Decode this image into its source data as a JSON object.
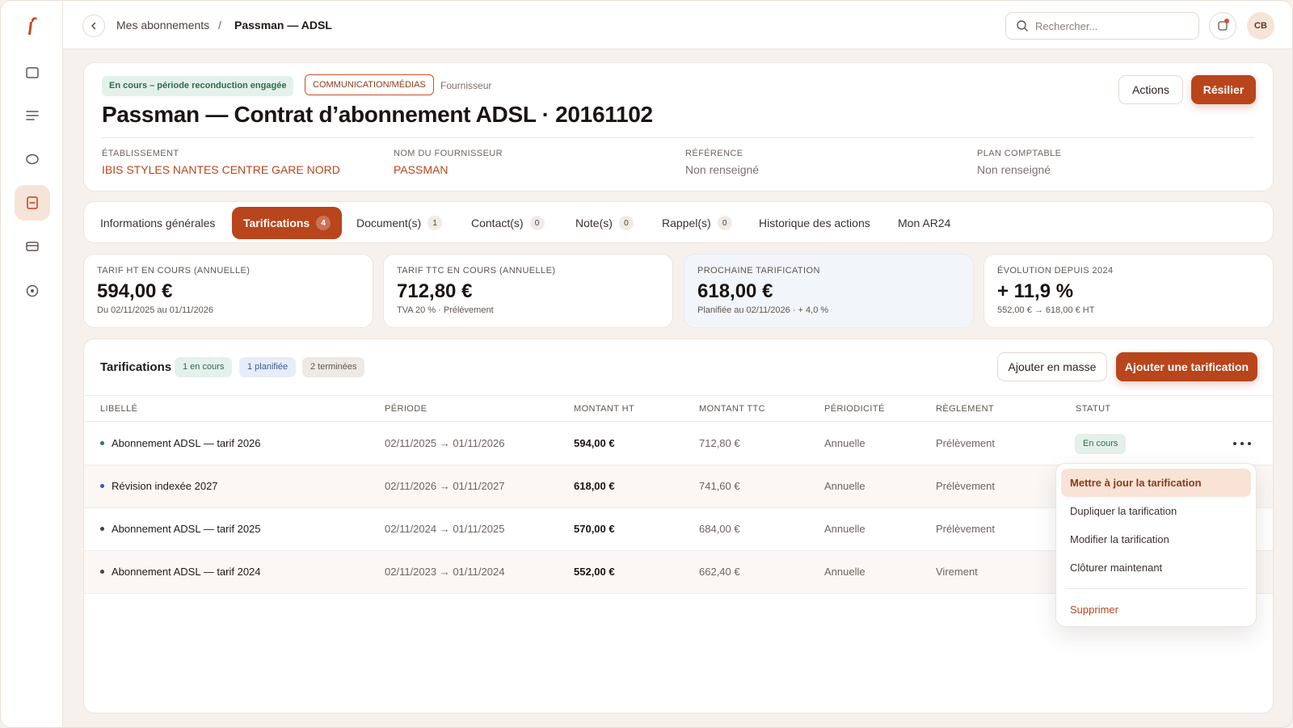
{
  "breadcrumb": {
    "parent": "Mes abonnements",
    "separator": "/",
    "current": "Passman — ADSL"
  },
  "search": {
    "placeholder": "Rechercher..."
  },
  "user": {
    "initials": "CB"
  },
  "sidebar": {
    "items": [
      {
        "icon": "square-icon",
        "active": false
      },
      {
        "icon": "list-icon",
        "active": false
      },
      {
        "icon": "circle-icon",
        "active": false
      },
      {
        "icon": "document-icon",
        "active": true
      },
      {
        "icon": "card-icon",
        "active": false
      },
      {
        "icon": "target-icon",
        "active": false
      }
    ]
  },
  "header": {
    "status_badge": "En cours – période reconduction engagée",
    "category_badge": "COMMUNICATION/MÉDIAS",
    "kind": "Fournisseur",
    "title": "Passman — Contrat d’abonnement ADSL · 20161102",
    "actions_label": "Actions",
    "resilier_label": "Résilier",
    "meta": [
      {
        "label": "ÉTABLISSEMENT",
        "value": "IBIS STYLES NANTES CENTRE GARE NORD"
      },
      {
        "label": "NOM DU FOURNISSEUR",
        "value": "PASSMAN"
      },
      {
        "label": "RÉFÉRENCE",
        "value": "Non renseigné"
      },
      {
        "label": "PLAN COMPTABLE",
        "value": "Non renseigné"
      }
    ]
  },
  "tabs": [
    {
      "label": "Informations générales",
      "count": null
    },
    {
      "label": "Tarifications",
      "count": "4"
    },
    {
      "label": "Document(s)",
      "count": "1"
    },
    {
      "label": "Contact(s)",
      "count": "0"
    },
    {
      "label": "Note(s)",
      "count": "0"
    },
    {
      "label": "Rappel(s)",
      "count": "0"
    },
    {
      "label": "Historique des actions",
      "count": null
    },
    {
      "label": "Mon AR24",
      "count": null
    }
  ],
  "kpis": [
    {
      "label": "TARIF HT EN COURS (ANNUELLE)",
      "value": "594,00 €",
      "sub": "Du 02/11/2025 au 01/11/2026"
    },
    {
      "label": "TARIF TTC EN COURS (ANNUELLE)",
      "value": "712,80 €",
      "sub": "TVA 20 % · Prélèvement"
    },
    {
      "label": "PROCHAINE TARIFICATION",
      "value": "618,00 €",
      "sub": "Planifiée au 02/11/2026 · + 4,0 %"
    },
    {
      "label": "ÉVOLUTION DEPUIS 2024",
      "value": "+ 11,9 %",
      "sub": "552,00 € → 618,00 € HT"
    }
  ],
  "table": {
    "title": "Tarifications",
    "chips": {
      "en_cours": "1 en cours",
      "planifiee": "1 planifiée",
      "terminees": "2 terminées"
    },
    "masse_label": "Ajouter en masse",
    "add_label": "Ajouter une tarification",
    "columns": [
      "LIBELLÉ",
      "PÉRIODE",
      "MONTANT HT",
      "MONTANT TTC",
      "PÉRIODICITÉ",
      "RÈGLEMENT",
      "STATUT"
    ],
    "rows": [
      {
        "label": "Abonnement ADSL — tarif 2026",
        "dot": "#2f7a55",
        "period": "02/11/2025 → 01/11/2026",
        "ht": "594,00 €",
        "ttc": "712,80 €",
        "periodicity": "Annuelle",
        "payment": "Prélèvement",
        "status": "En cours"
      },
      {
        "label": "Révision indexée 2027",
        "dot": "#3d5d92",
        "period": "02/11/2026 → 01/11/2027",
        "ht": "618,00 €",
        "ttc": "741,60 €",
        "periodicity": "Annuelle",
        "payment": "Prélèvement",
        "status": ""
      },
      {
        "label": "Abonnement ADSL — tarif 2025",
        "dot": "#4a423c",
        "period": "02/11/2024 → 01/11/2025",
        "ht": "570,00 €",
        "ttc": "684,00 €",
        "periodicity": "Annuelle",
        "payment": "Prélèvement",
        "status": ""
      },
      {
        "label": "Abonnement ADSL — tarif 2024",
        "dot": "#4a423c",
        "period": "02/11/2023 → 01/11/2024",
        "ht": "552,00 €",
        "ttc": "662,40 €",
        "periodicity": "Annuelle",
        "payment": "Virement",
        "status": ""
      }
    ]
  },
  "menu": {
    "items": [
      "Mettre à jour la tarification",
      "Dupliquer la tarification",
      "Modifier la tarification",
      "Clôturer maintenant"
    ],
    "danger": "Supprimer"
  },
  "colors": {
    "accent": "#b8451c",
    "success": "#2f6b4b",
    "info": "#3d5d92"
  }
}
